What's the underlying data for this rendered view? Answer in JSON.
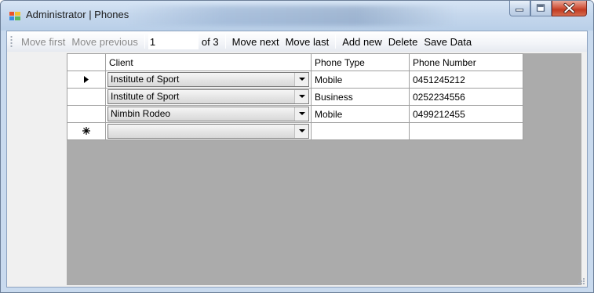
{
  "window": {
    "title": "Administrator | Phones",
    "icon": "form-icon",
    "buttons": [
      "minimize",
      "maximize",
      "close"
    ]
  },
  "toolbar": {
    "move_first": "Move first",
    "move_previous": "Move previous",
    "position": "1",
    "count": "of 3",
    "move_next": "Move next",
    "move_last": "Move last",
    "add_new": "Add new",
    "delete": "Delete",
    "save_data": "Save Data"
  },
  "grid": {
    "columns": [
      "Client",
      "Phone Type",
      "Phone Number"
    ],
    "rows": [
      {
        "marker": "current-row-arrow",
        "client": "Institute of Sport",
        "phone_type": "Mobile",
        "phone_number": "0451245212"
      },
      {
        "marker": "",
        "client": "Institute of Sport",
        "phone_type": "Business",
        "phone_number": "0252234556"
      },
      {
        "marker": "",
        "client": "Nimbin Rodeo",
        "phone_type": "Mobile",
        "phone_number": "0499212455"
      }
    ],
    "new_row": {
      "marker": "new-row-asterisk",
      "client": "",
      "phone_type": "",
      "phone_number": ""
    }
  },
  "colors": {
    "grid_background": "#ababab",
    "title_bar": "#c6d8ed",
    "close_button": "#c23b22"
  }
}
